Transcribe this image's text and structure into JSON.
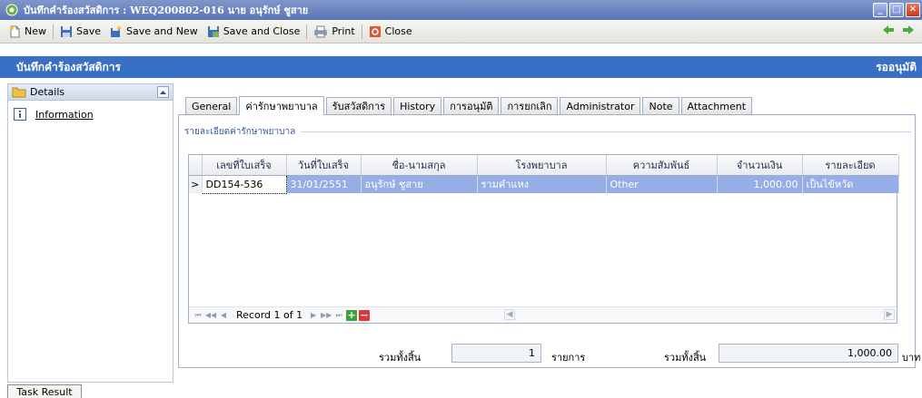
{
  "window": {
    "title": "บันทึกคำร้องสวัสดิการ : WEQ200802-016 นาย อนุรักษ์ ชูสาย",
    "app_icon": "app-icon",
    "controls": {
      "minimize": "_",
      "maximize": "□",
      "close": "✕"
    }
  },
  "toolbar": {
    "new_label": "New",
    "save_label": "Save",
    "save_new_label": "Save and New",
    "save_close_label": "Save and Close",
    "print_label": "Print",
    "close_label": "Close"
  },
  "header": {
    "title": "บันทึกคำร้องสวัสดิการ",
    "status": "รออนุมัติ"
  },
  "sidebar": {
    "section_label": "Details",
    "items": [
      {
        "label": "Information",
        "icon": "info-icon"
      }
    ]
  },
  "tabs": [
    {
      "label": "General",
      "active": false
    },
    {
      "label": "ค่ารักษาพยาบาล",
      "active": true
    },
    {
      "label": "รับสวัสดิการ",
      "active": false
    },
    {
      "label": "History",
      "active": false
    },
    {
      "label": "การอนุมัติ",
      "active": false
    },
    {
      "label": "การยกเลิก",
      "active": false
    },
    {
      "label": "Administrator",
      "active": false
    },
    {
      "label": "Note",
      "active": false
    },
    {
      "label": "Attachment",
      "active": false
    }
  ],
  "section": {
    "legend": "รายละเอียดค่ารักษาพยาบาล"
  },
  "grid": {
    "columns": [
      "เลขที่ใบเสร็จ",
      "วันที่ใบเสร็จ",
      "ชื่อ-นามสกุล",
      "โรงพยาบาล",
      "ความสัมพันธ์",
      "จำนวนเงิน",
      "รายละเอียด"
    ],
    "rows": [
      {
        "receipt_no": "DD154-536",
        "receipt_date": "31/01/2551",
        "name": "อนุรักษ์ ชูสาย",
        "hospital": "รามคำแหง",
        "relation": "Other",
        "amount": "1,000.00",
        "detail": "เป็นไข้หวัด"
      }
    ],
    "row_indicator": ">",
    "navigator": {
      "record_text": "Record 1 of 1"
    }
  },
  "summary": {
    "count_label": "รวมทั้งสิ้น",
    "count_value": "1",
    "count_unit": "รายการ",
    "total_label": "รวมทั้งสิ้น",
    "total_value": "1,000.00",
    "total_unit": "บาท"
  },
  "footer": {
    "task_result_label": "Task Result"
  },
  "colors": {
    "header_band": "#3a6fc6",
    "titlebar": "#6a83c0",
    "selected_row": "#96aee6"
  }
}
